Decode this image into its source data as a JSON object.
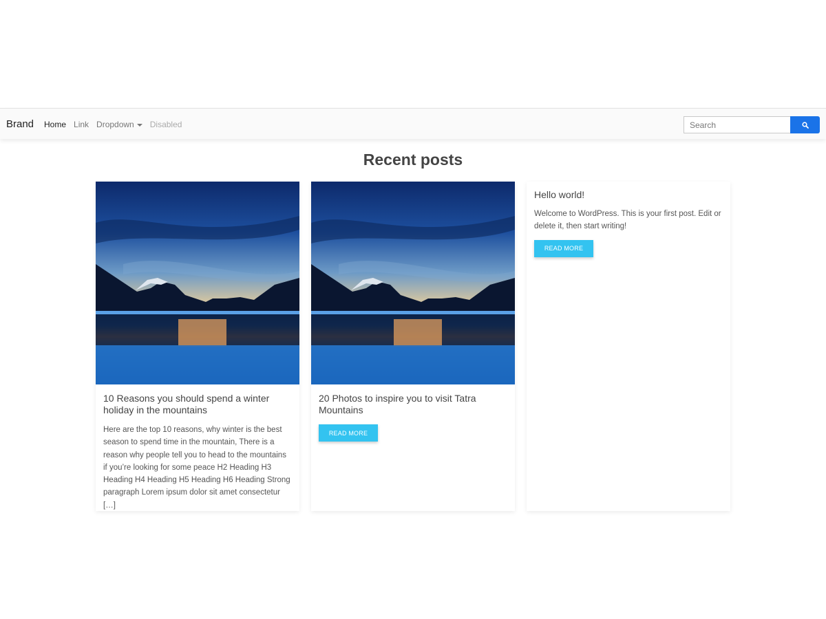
{
  "navbar": {
    "brand": "Brand",
    "links": [
      {
        "label": "Home"
      },
      {
        "label": "Link"
      },
      {
        "label": "Dropdown"
      },
      {
        "label": "Disabled"
      }
    ],
    "search_placeholder": "Search",
    "search_icon": "search-icon",
    "accent_color": "#1a73e8"
  },
  "main": {
    "title": "Recent posts",
    "posts": [
      {
        "image": "mountain-lake-sunset",
        "title": "10 Reasons you should spend a winter holiday in the mountains",
        "excerpt": "Here are the top 10 reasons, why winter is the best season to spend time in the mountain, There is a reason why people tell you to head to the mountains if you’re looking for some peace H2 Heading H3 Heading H4 Heading H5 Heading H6 Heading Strong paragraph Lorem ipsum dolor sit amet consectetur […]"
      },
      {
        "image": "mountain-lake-sunset",
        "title": "20 Photos to inspire you to visit Tatra Mountains",
        "button": "READ MORE"
      },
      {
        "title": "Hello world!",
        "excerpt": "Welcome to WordPress. This is your first post. Edit or delete it, then start writing!",
        "button": "READ MORE"
      }
    ],
    "button_color": "#33c3f0"
  }
}
